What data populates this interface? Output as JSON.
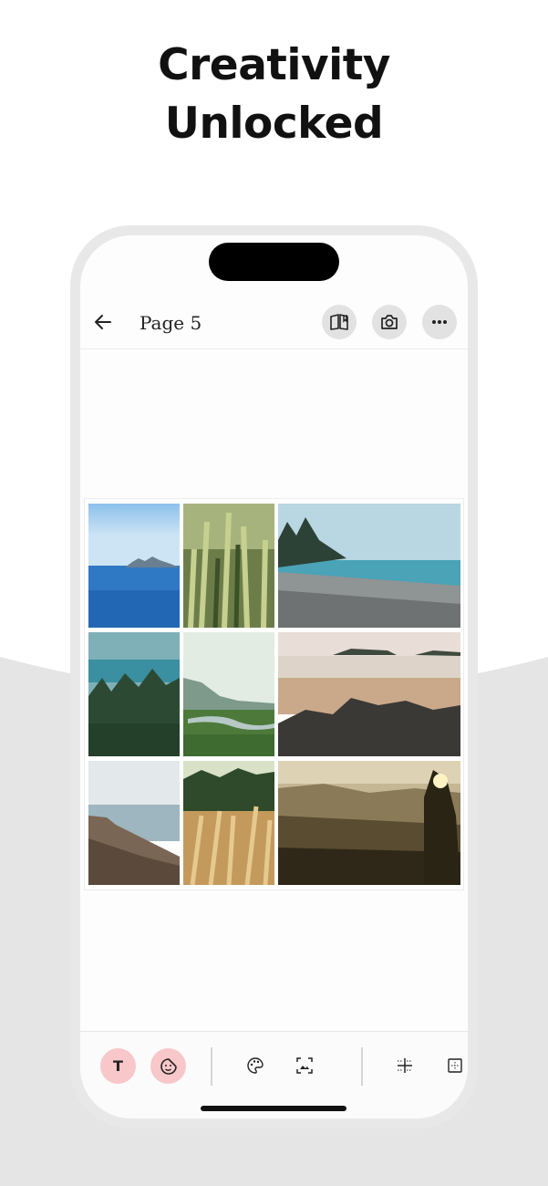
{
  "promo": {
    "headline_line1": "Creativity",
    "headline_line2": "Unlocked"
  },
  "topbar": {
    "title": "Page 5"
  },
  "icons": {
    "back": "arrow-left-icon",
    "book": "open-book-icon",
    "camera": "camera-icon",
    "more": "more-horizontal-icon",
    "text": "text-icon",
    "sticker": "sticker-icon",
    "palette": "palette-icon",
    "background": "image-frame-icon",
    "grid": "grid-layout-icon",
    "layout": "layout-icon"
  },
  "toolbar": {
    "text_label": "T"
  },
  "colors": {
    "accent_pink": "#f8c7c9",
    "phone_frame": "#e8e8e8",
    "background_gray": "#e5e5e5"
  }
}
